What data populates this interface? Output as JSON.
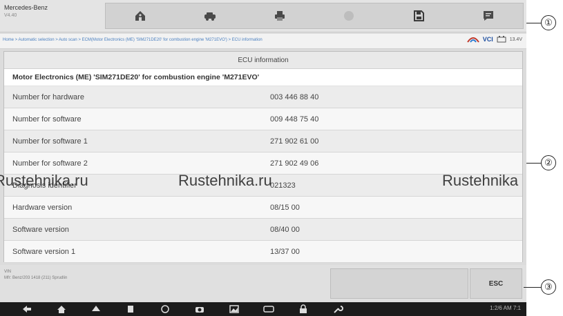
{
  "vehicle": {
    "make": "Mercedes-Benz",
    "version": "V4.40"
  },
  "toolbar": {
    "buttons": [
      {
        "name": "home-icon"
      },
      {
        "name": "vehicle-swap-icon"
      },
      {
        "name": "print-icon"
      },
      {
        "name": "help-icon"
      },
      {
        "name": "save-icon"
      },
      {
        "name": "data-logging-icon"
      }
    ]
  },
  "breadcrumb": "Home > Automatic selection > Auto scan > ECM(Motor Electronics (ME) 'SIM271DE20' for combustion engine 'M271EVO') > ECU information",
  "status": {
    "vci": "VCI",
    "battery": "13.4V"
  },
  "panel": {
    "title": "ECU information",
    "ecu_name": "Motor Electronics (ME) 'SIM271DE20' for combustion engine 'M271EVO'",
    "rows": [
      {
        "label": "Number for hardware",
        "value": "003 446 88 40"
      },
      {
        "label": "Number for software",
        "value": "009 448 75 40"
      },
      {
        "label": "Number for software 1",
        "value": "271 902 61 00"
      },
      {
        "label": "Number for software 2",
        "value": "271 902 49 06"
      },
      {
        "label": "Diagnosis identifier",
        "value": "021323"
      },
      {
        "label": "Hardware version",
        "value": "08/15 00"
      },
      {
        "label": "Software version",
        "value": "08/40 00"
      },
      {
        "label": "Software version 1",
        "value": "13/37 00"
      }
    ]
  },
  "footer": {
    "vin_label": "VIN",
    "vehicle_line": "Mfr: Benz/203 1418 (211) Sprudlin",
    "esc_label": "ESC"
  },
  "navbar": {
    "status": "1:2/6 AM 7:1"
  },
  "watermarks": [
    "Rustehnika.ru",
    "Rustehnika.ru",
    "Rustehnika"
  ],
  "callouts": [
    "①",
    "②",
    "③"
  ]
}
